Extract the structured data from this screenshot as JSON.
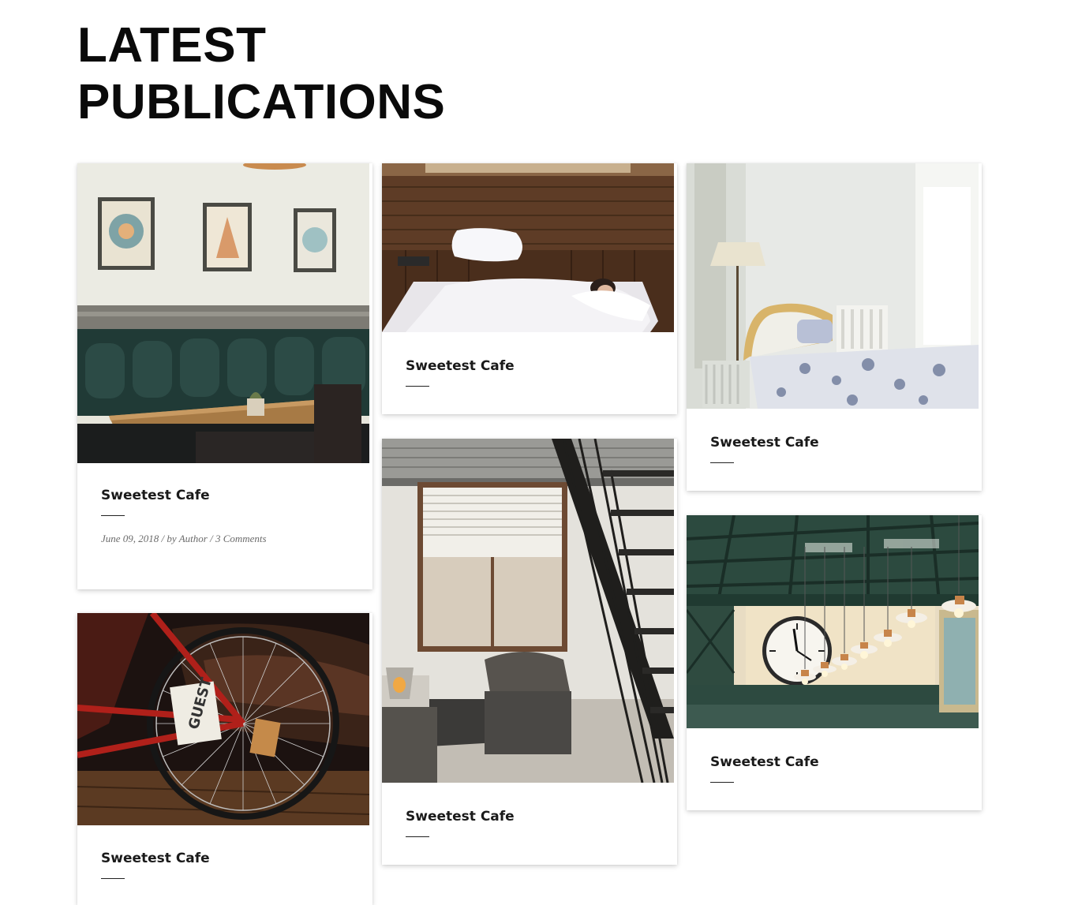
{
  "header": {
    "title_line1": "LATEST",
    "title_line2": "PUBLICATIONS"
  },
  "cards": [
    {
      "image": "cafe-leather-booth-photo",
      "title": "Sweetest Cafe",
      "meta": {
        "date": "June 09, 2018",
        "by": "by",
        "author": "Author",
        "comments": "3 Comments"
      }
    },
    {
      "image": "attic-bedroom-photo",
      "title": "Sweetest Cafe"
    },
    {
      "image": "white-bedroom-photo",
      "title": "Sweetest Cafe"
    },
    {
      "image": "bicycle-leather-sofa-photo",
      "title": "Sweetest Cafe"
    },
    {
      "image": "loft-staircase-living-photo",
      "title": "Sweetest Cafe"
    },
    {
      "image": "station-clock-pendant-lamps-photo",
      "title": "Sweetest Cafe"
    }
  ]
}
